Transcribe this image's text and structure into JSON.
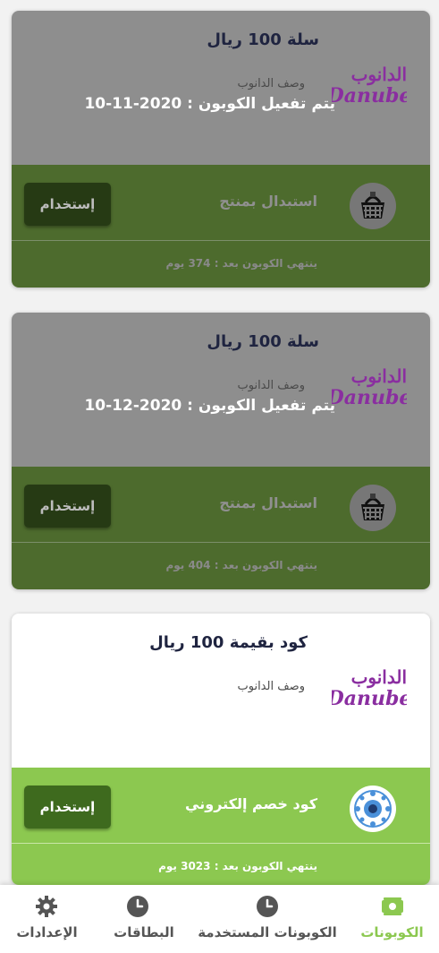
{
  "colors": {
    "accent": "#8cc850",
    "disabled_top": "#8e8e8e",
    "disabled_bottom": "#4d6b2d",
    "active_bottom": "#8cc850",
    "logo_purple": "#8a2ea0"
  },
  "brand": {
    "arabic": "الدانوب",
    "latin": "Danube"
  },
  "coupons": [
    {
      "state": "disabled",
      "title": "سلة 100 ريال",
      "description": "وصف الدانوب",
      "activation": "يتم تفعيل الكوبون : 2020-11-10",
      "type_icon": "basket-icon",
      "type_label": "استبدال بمنتج",
      "button_label": "إستخدام",
      "expiry": "ينتهي الكوبون بعد : 374 يوم"
    },
    {
      "state": "disabled",
      "title": "سلة 100 ريال",
      "description": "وصف الدانوب",
      "activation": "يتم تفعيل الكوبون : 2020-12-10",
      "type_icon": "basket-icon",
      "type_label": "استبدال بمنتج",
      "button_label": "إستخدام",
      "expiry": "ينتهي الكوبون بعد : 404 يوم"
    },
    {
      "state": "active",
      "title": "كود بقيمة 100 ريال",
      "description": "وصف الدانوب",
      "activation": "",
      "type_icon": "digital-code-icon",
      "type_label": "كود خصم إلكتروني",
      "button_label": "إستخدام",
      "expiry": "ينتهي الكوبون بعد : 3023 يوم"
    }
  ],
  "tabs": [
    {
      "label": "الكوبونات",
      "icon": "coupon-icon",
      "selected": true
    },
    {
      "label": "الكوبونات المستخدمة",
      "icon": "clock-icon",
      "selected": false
    },
    {
      "label": "البطاقات",
      "icon": "clock-icon",
      "selected": false
    },
    {
      "label": "الإعدادات",
      "icon": "gear-icon",
      "selected": false
    }
  ]
}
